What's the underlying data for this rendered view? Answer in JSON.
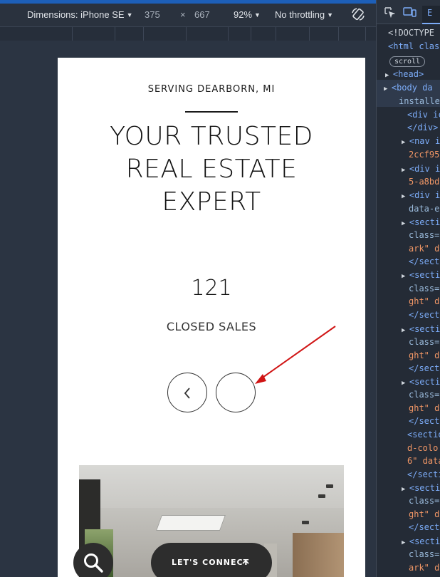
{
  "toolbar": {
    "dimensions_label": "Dimensions: iPhone SE",
    "width": "375",
    "times": "×",
    "height": "667",
    "zoom": "92%",
    "throttling": "No throttling",
    "caret": "▼"
  },
  "page": {
    "serving": "SERVING DEARBORN, MI",
    "headline": [
      "YOUR TRUSTED",
      "REAL ESTATE",
      "EXPERT"
    ],
    "count": "121",
    "count_label": "CLOSED SALES",
    "connect_label": "LET'S CONNECT"
  },
  "devtools": {
    "tab_label": "E",
    "lines": [
      {
        "text": "<!DOCTYPE",
        "kind": "gray"
      },
      {
        "text": "<html clas",
        "kind": "tag"
      },
      {
        "text": "scroll",
        "kind": "pill"
      },
      {
        "text": "<head>",
        "kind": "tag"
      },
      {
        "text": "<body da",
        "kind": "tag"
      },
      {
        "text": "installe",
        "kind": "attr"
      },
      {
        "text": "<div ic",
        "kind": "tag"
      },
      {
        "text": "</div>",
        "kind": "tag"
      },
      {
        "text": "<nav i",
        "kind": "tag"
      },
      {
        "text": "2ccf95",
        "kind": "val"
      },
      {
        "text": "<div i",
        "kind": "tag"
      },
      {
        "text": "5-a8bd",
        "kind": "val"
      },
      {
        "text": "<div i",
        "kind": "tag"
      },
      {
        "text": "data-e",
        "kind": "attr"
      },
      {
        "text": "<secti",
        "kind": "tag"
      },
      {
        "text": "class=",
        "kind": "attr"
      },
      {
        "text": "ark\" d",
        "kind": "val"
      },
      {
        "text": "</sect",
        "kind": "tag"
      },
      {
        "text": "<secti",
        "kind": "tag"
      },
      {
        "text": "class=",
        "kind": "attr"
      },
      {
        "text": "ght\" d",
        "kind": "val"
      },
      {
        "text": "</sect",
        "kind": "tag"
      },
      {
        "text": "<secti",
        "kind": "tag"
      },
      {
        "text": "class=",
        "kind": "attr"
      },
      {
        "text": "ght\" d",
        "kind": "val"
      },
      {
        "text": "</sect",
        "kind": "tag"
      },
      {
        "text": "<secti",
        "kind": "tag"
      },
      {
        "text": "class=",
        "kind": "attr"
      },
      {
        "text": "ght\" d",
        "kind": "val"
      },
      {
        "text": "</sect",
        "kind": "tag"
      },
      {
        "text": "<sectio",
        "kind": "tag"
      },
      {
        "text": "d-colo",
        "kind": "val"
      },
      {
        "text": "6\" data",
        "kind": "val"
      },
      {
        "text": "</secti",
        "kind": "tag"
      },
      {
        "text": "<secti",
        "kind": "tag"
      },
      {
        "text": "class=",
        "kind": "attr"
      },
      {
        "text": "ght\" d",
        "kind": "val"
      },
      {
        "text": "</sect",
        "kind": "tag"
      },
      {
        "text": "<secti",
        "kind": "tag"
      },
      {
        "text": "class=",
        "kind": "attr"
      },
      {
        "text": "ark\" d",
        "kind": "val"
      }
    ]
  },
  "colors": {
    "accent": "#1d5fb8",
    "annotation_arrow": "#d01414",
    "button_dark": "#2d2d2d"
  }
}
